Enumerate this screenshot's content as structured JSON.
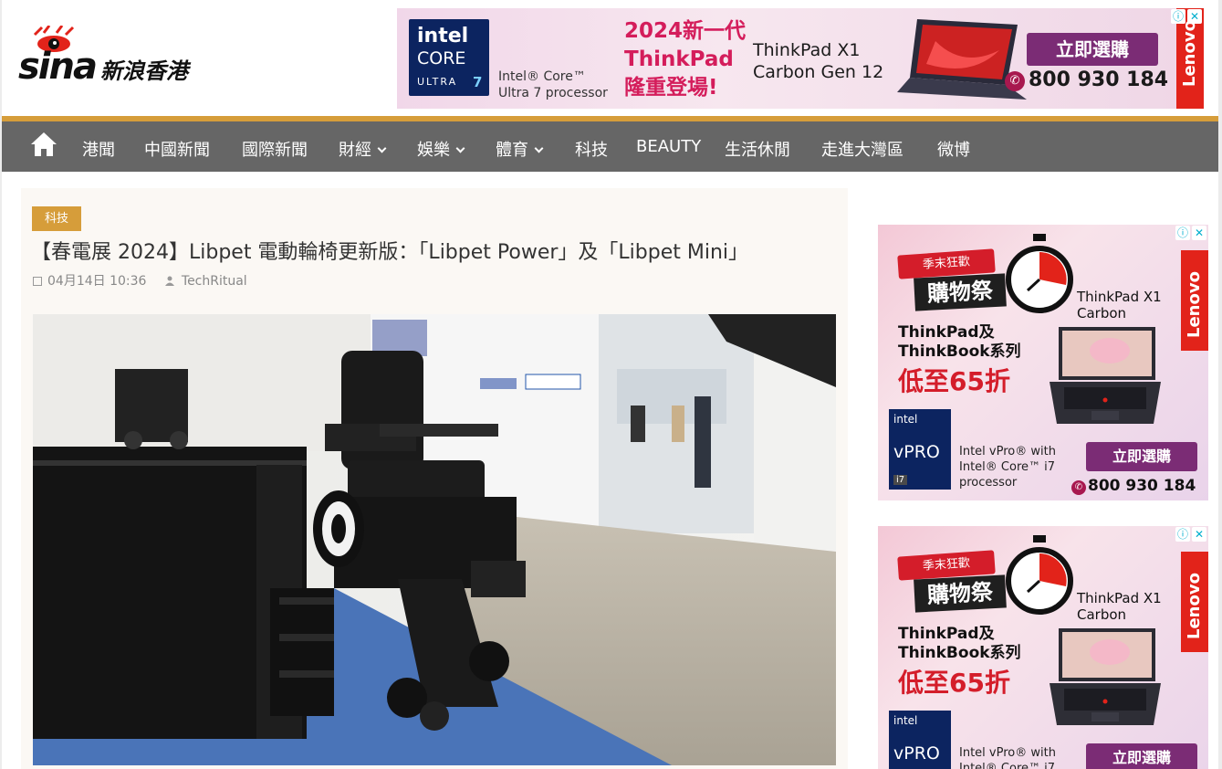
{
  "site": {
    "logo_brand": "sina",
    "logo_sub": "新浪香港"
  },
  "top_ad": {
    "intel_line1": "intel",
    "intel_line2": "CORE",
    "intel_line3": "ULTRA",
    "intel_line4": "7",
    "core_text_1": "Intel® Core™",
    "core_text_2": "Ultra 7 processor",
    "headline_1": "2024新一代",
    "headline_2": "ThinkPad",
    "headline_3": "隆重登場!",
    "model_1": "ThinkPad X1",
    "model_2": "Carbon Gen 12",
    "cta": "立即選購",
    "phone": "800 930 184",
    "brand": "Lenovo"
  },
  "nav": {
    "items": [
      {
        "label": "港聞",
        "dropdown": false
      },
      {
        "label": "中國新聞",
        "dropdown": false
      },
      {
        "label": "國際新聞",
        "dropdown": false
      },
      {
        "label": "財經",
        "dropdown": true
      },
      {
        "label": "娛樂",
        "dropdown": true
      },
      {
        "label": "體育",
        "dropdown": true
      },
      {
        "label": "科技",
        "dropdown": false
      },
      {
        "label": "BEAUTY",
        "dropdown": false
      },
      {
        "label": "生活休閒",
        "dropdown": false
      },
      {
        "label": "走進大灣區",
        "dropdown": false
      },
      {
        "label": "微博",
        "dropdown": false
      }
    ]
  },
  "article": {
    "category": "科技",
    "title": "【春電展 2024】Libpet 電動輪椅更新版：「Libpet Power」及「Libpet Mini」",
    "date": "04月14日 10:36",
    "author": "TechRitual"
  },
  "side_ad": {
    "badge": "季末狂歡",
    "sale": "購物祭",
    "model_1": "ThinkPad X1",
    "model_2": "Carbon",
    "series_1": "ThinkPad及",
    "series_2": "ThinkBook系列",
    "discount": "低至65折",
    "vpro_a": "intel",
    "vpro_b": "vPRO",
    "vpro_c": "i7",
    "vpro_text_1": "Intel vPro® with",
    "vpro_text_2": "Intel® Core™ i7",
    "vpro_text_3": "processor",
    "cta": "立即選購",
    "phone": "800 930 184",
    "brand": "Lenovo"
  },
  "colors": {
    "accent": "#d69d3a",
    "nav_bg": "#666666",
    "ad_purple": "#7b2c75",
    "lenovo_red": "#e2231a",
    "intel_blue": "#0c2460"
  }
}
